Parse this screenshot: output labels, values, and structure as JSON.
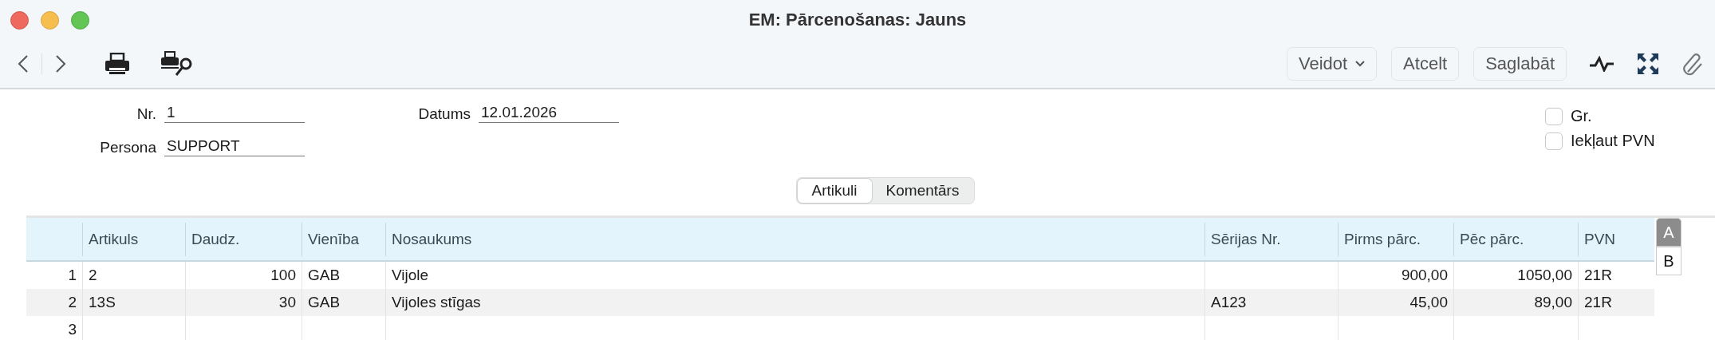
{
  "window": {
    "title": "EM: Pārcenošanas: Jauns"
  },
  "toolbar": {
    "buttons": [
      {
        "label": "Veidot",
        "kind": "menu"
      },
      {
        "label": "Atcelt",
        "kind": "plain"
      },
      {
        "label": "Saglabāt",
        "kind": "plain"
      }
    ]
  },
  "form": {
    "fields": [
      {
        "label": "Nr.",
        "value": "1"
      },
      {
        "label": "Persona",
        "value": "SUPPORT"
      }
    ],
    "date": {
      "label": "Datums",
      "value": "12.01.2026"
    },
    "checkboxes": [
      {
        "label": "Gr.",
        "checked": false
      },
      {
        "label": "Iekļaut PVN",
        "checked": false
      }
    ]
  },
  "tabs": [
    {
      "label": "Artikuli",
      "selected": true
    },
    {
      "label": "Komentārs",
      "selected": false
    }
  ],
  "table": {
    "columns": [
      {
        "kind": "index"
      },
      {
        "label": "Artikuls",
        "kind": "text"
      },
      {
        "label": "Daudz.",
        "kind": "number"
      },
      {
        "label": "Vienība",
        "kind": "text"
      },
      {
        "label": "Nosaukums",
        "kind": "text"
      },
      {
        "label": "Sērijas Nr.",
        "kind": "text"
      },
      {
        "label": "Pirms pārc.",
        "kind": "number"
      },
      {
        "label": "Pēc pārc.",
        "kind": "number"
      },
      {
        "label": "PVN",
        "kind": "text"
      }
    ],
    "rows": [
      [
        "1",
        "2",
        "100",
        "GAB",
        "Vijole",
        "",
        "900,00",
        "1050,00",
        "21R"
      ],
      [
        "2",
        "13S",
        "30",
        "GAB",
        "Vijoles stīgas",
        "A123",
        "45,00",
        "89,00",
        "21R"
      ],
      [
        "3",
        "",
        "",
        "",
        "",
        "",
        "",
        "",
        ""
      ]
    ]
  },
  "side_tabs": [
    {
      "label": "A",
      "selected": true
    },
    {
      "label": "B",
      "selected": false
    }
  ]
}
